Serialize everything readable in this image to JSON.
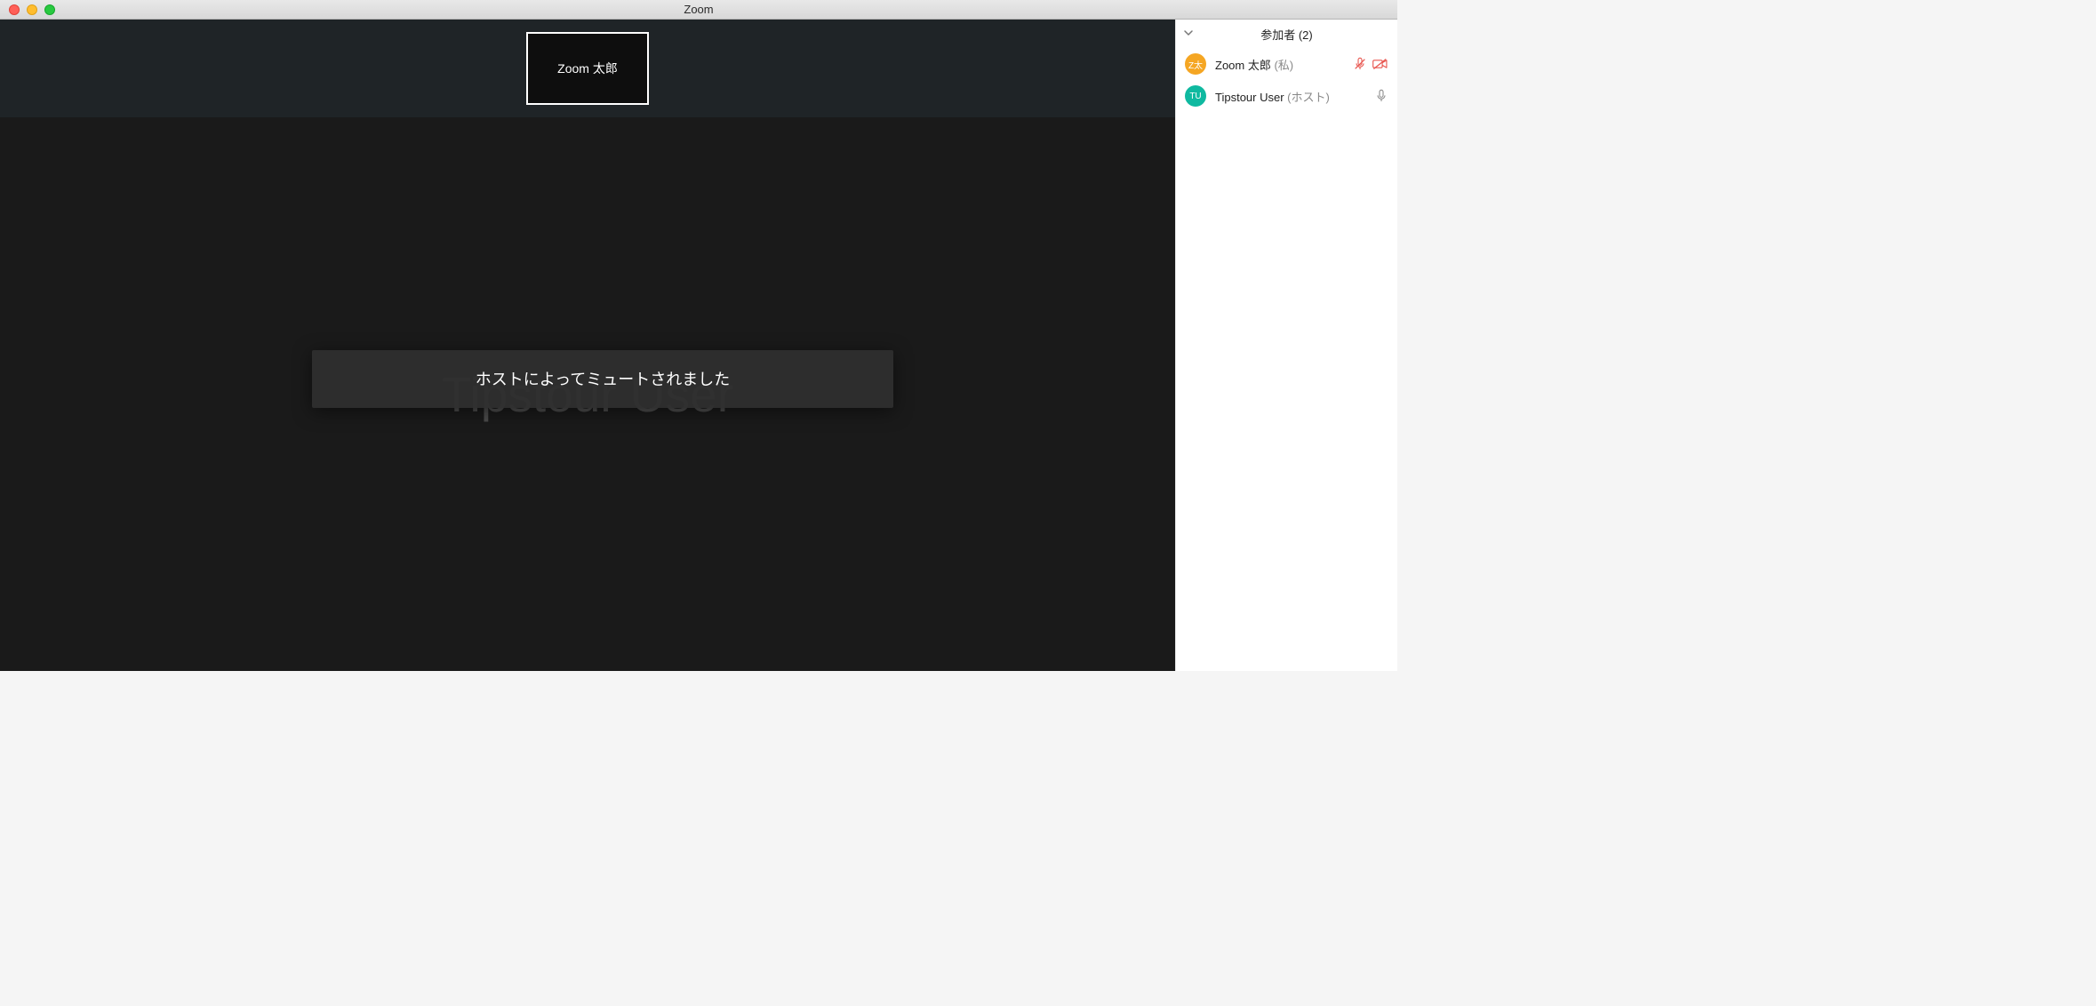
{
  "window": {
    "title": "Zoom"
  },
  "selfView": {
    "name": "Zoom 太郎"
  },
  "mainView": {
    "name": "Tipstour User"
  },
  "toast": {
    "message": "ホストによってミュートされました"
  },
  "participantsPanel": {
    "title": "参加者 (2)",
    "collapseIcon": "chevron-down",
    "items": [
      {
        "avatarText": "Z太",
        "avatarColor": "orange",
        "name": "Zoom 太郎",
        "suffix": "(私)",
        "micMuted": true,
        "videoOff": true,
        "micColor": "#e8554e",
        "videoColor": "#e8554e"
      },
      {
        "avatarText": "TU",
        "avatarColor": "teal",
        "name": "Tipstour User",
        "suffix": "(ホスト)",
        "micMuted": false,
        "videoOff": false,
        "micColor": "#8a8a8a",
        "videoColor": null
      }
    ]
  }
}
